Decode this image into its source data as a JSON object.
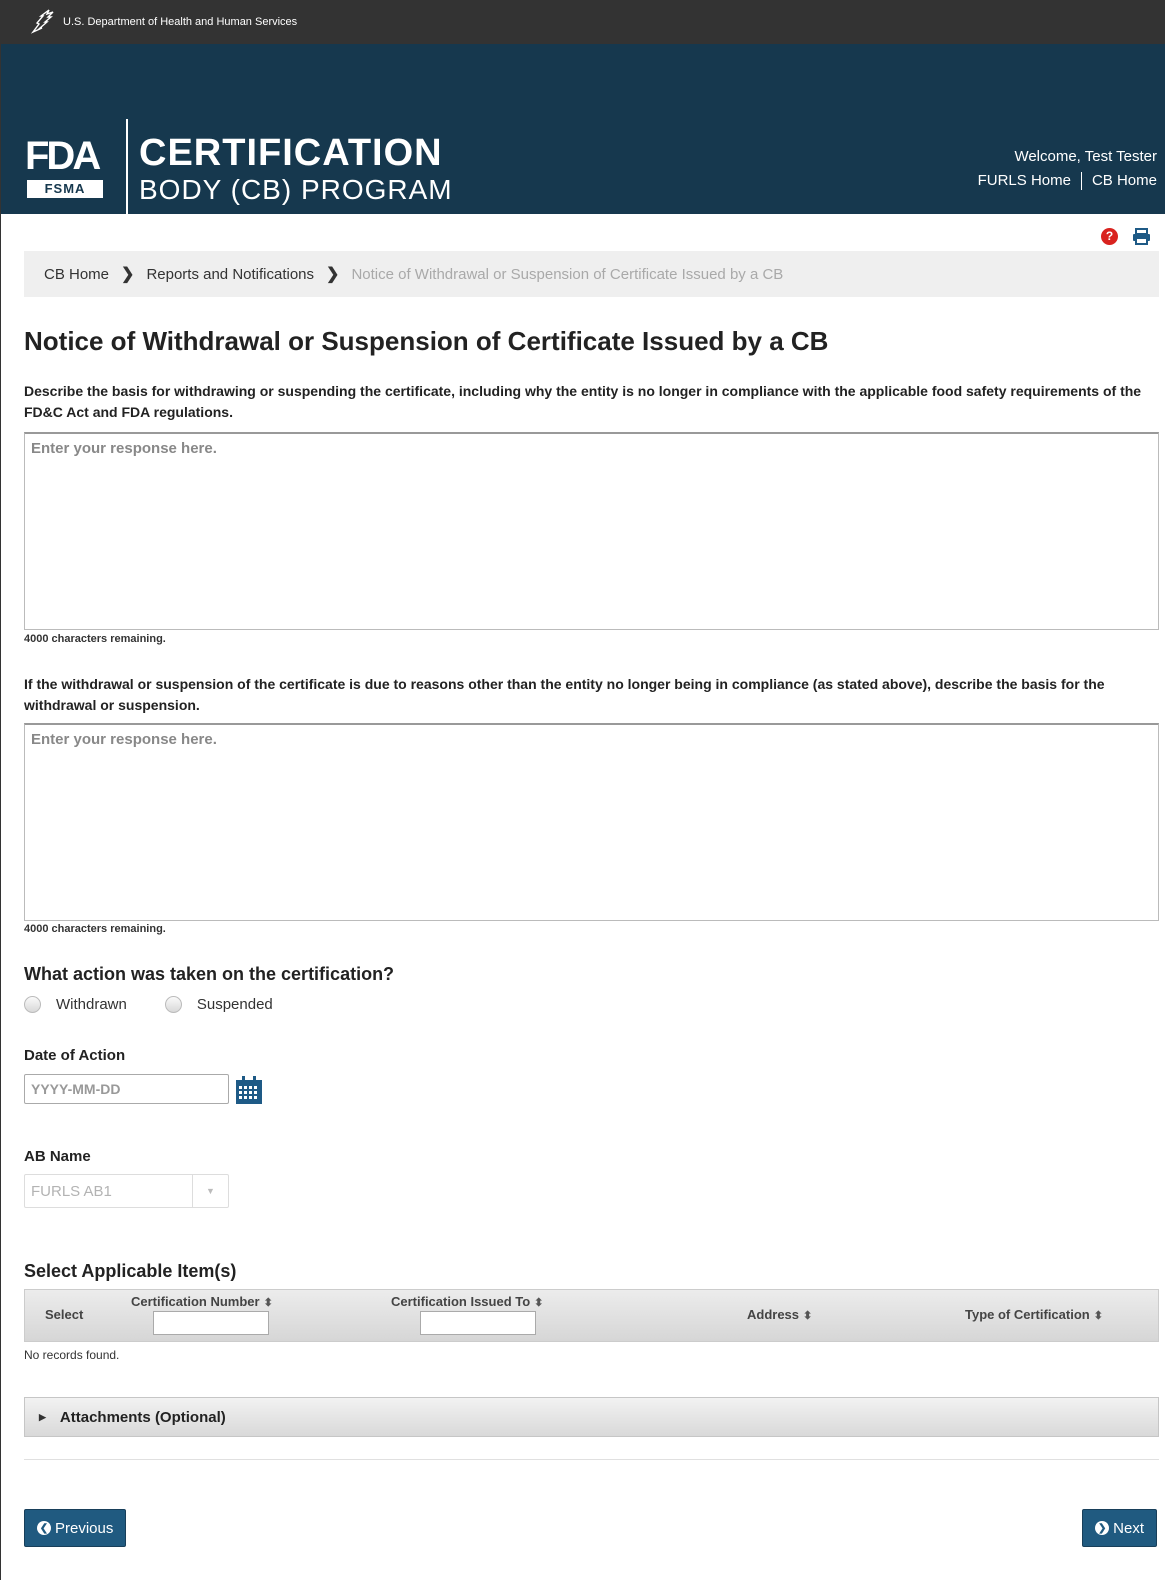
{
  "hhs_bar": {
    "text": "U.S. Department of Health and Human Services",
    "icon": "hhs-eagle-icon"
  },
  "header": {
    "logo_fda": "FDA",
    "logo_fsma": "FSMA",
    "title_line1": "CERTIFICATION",
    "title_line2": "BODY (CB) PROGRAM",
    "welcome": "Welcome, Test Tester",
    "link_furls_home": "FURLS Home",
    "link_cb_home": "CB Home",
    "bg_color": "#16384e"
  },
  "tools": {
    "help_icon": "?",
    "print_icon": "print-icon"
  },
  "breadcrumb": {
    "items": [
      "CB Home",
      "Reports and Notifications"
    ],
    "current": "Notice of Withdrawal or Suspension of Certificate Issued by a CB"
  },
  "page_title": "Notice of Withdrawal or Suspension of Certificate Issued by a CB",
  "question1": {
    "label": "Describe the basis for withdrawing or suspending the certificate, including why the entity is no longer in compliance with the applicable food safety requirements of the FD&C Act and FDA regulations.",
    "placeholder": "Enter your response here.",
    "remaining": "4000 characters remaining."
  },
  "question2": {
    "label": "If the withdrawal or suspension of the certificate is due to reasons other than the entity no longer being in compliance (as stated above), describe the basis for the withdrawal or suspension.",
    "placeholder": "Enter your response here.",
    "remaining": "4000 characters remaining."
  },
  "action": {
    "heading": "What action was taken on the certification?",
    "options": [
      "Withdrawn",
      "Suspended"
    ]
  },
  "date_of_action": {
    "label": "Date of Action",
    "placeholder": "YYYY-MM-DD"
  },
  "ab_name": {
    "label": "AB Name",
    "value": "FURLS AB1"
  },
  "items_table": {
    "heading": "Select Applicable Item(s)",
    "columns": [
      "Select",
      "Certification Number",
      "Certification Issued To",
      "Address",
      "Type of Certification"
    ],
    "empty_message": "No records found."
  },
  "attachments": {
    "label": "Attachments (Optional)"
  },
  "nav": {
    "previous": "Previous",
    "next": "Next",
    "button_color": "#205a80"
  }
}
